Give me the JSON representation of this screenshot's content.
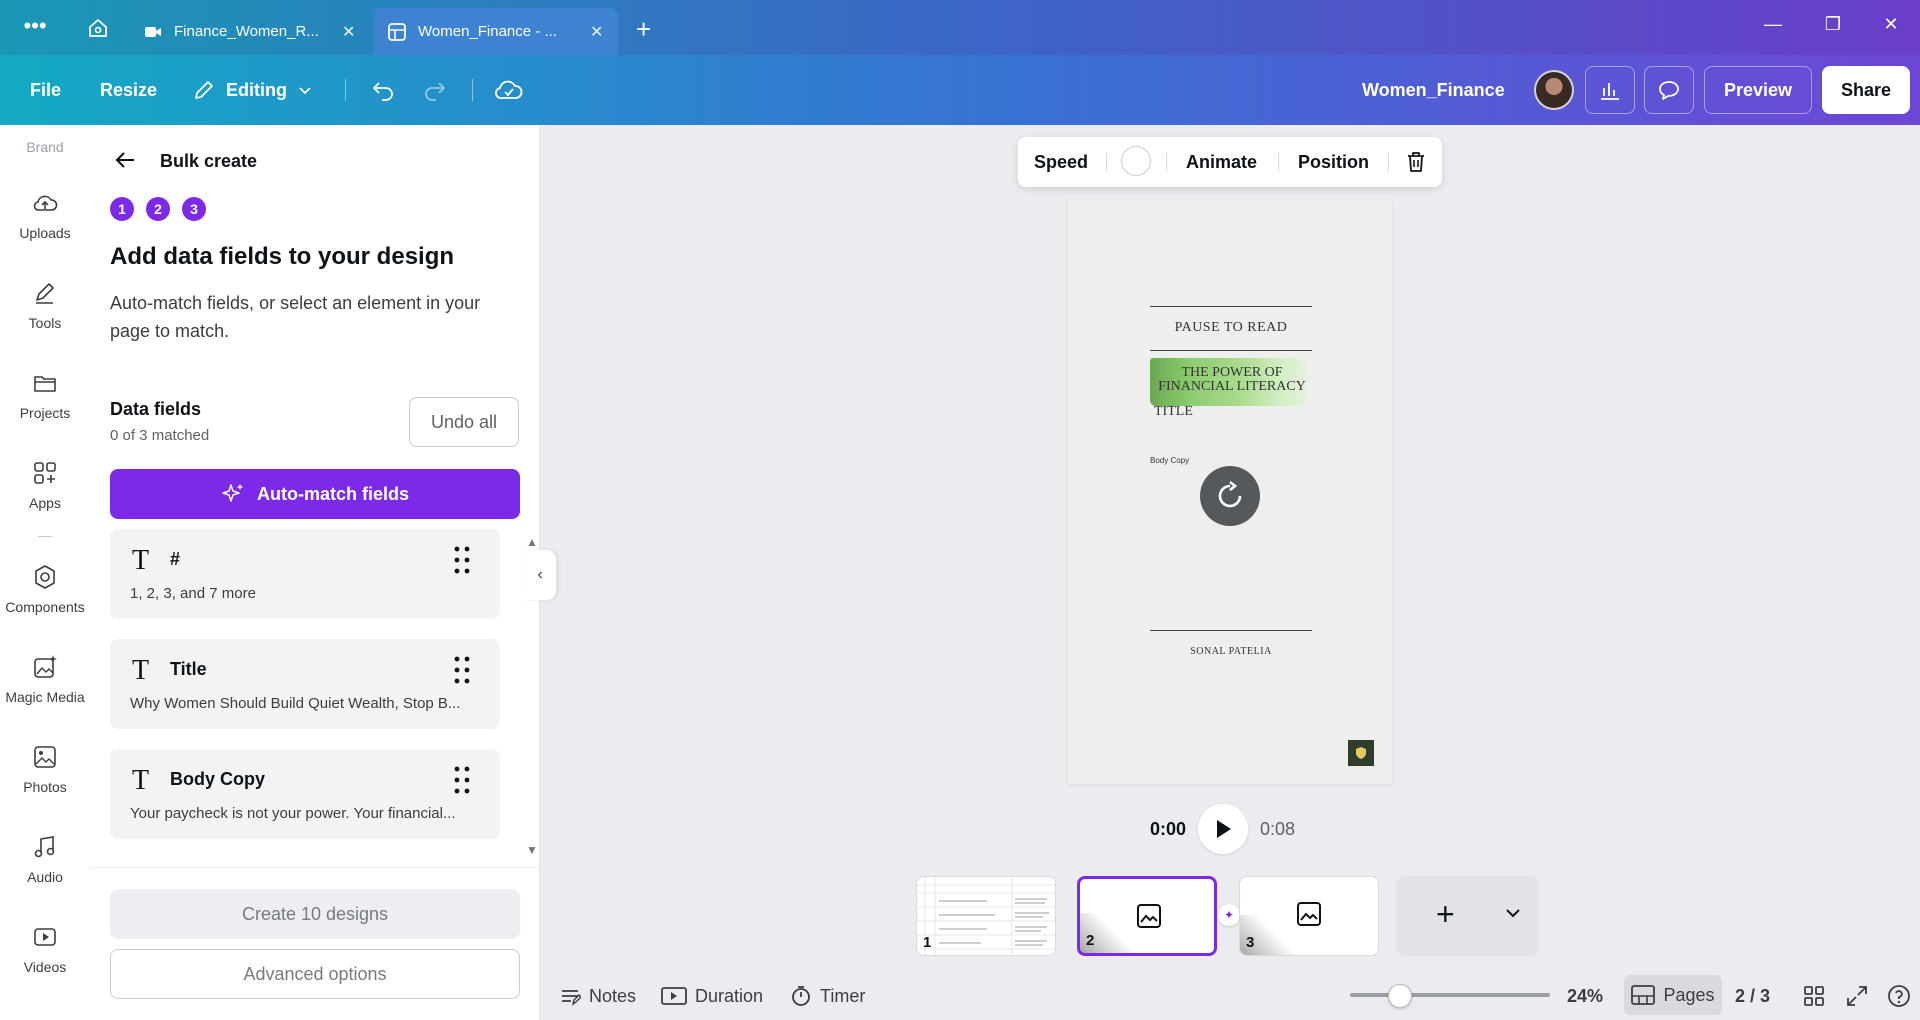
{
  "browser": {
    "tabs": [
      {
        "title": "Finance_Women_R...",
        "icon": "video-camera-icon",
        "active": false
      },
      {
        "title": "Women_Finance - ...",
        "icon": "sheet-icon",
        "active": true
      }
    ]
  },
  "toolbar": {
    "file": "File",
    "resize": "Resize",
    "editing": "Editing",
    "doc_title": "Women_Finance",
    "preview": "Preview",
    "share": "Share"
  },
  "rail": {
    "brand": "Brand",
    "items": [
      {
        "label": "Uploads",
        "icon": "upload-cloud-icon"
      },
      {
        "label": "Tools",
        "icon": "pen-icon"
      },
      {
        "label": "Projects",
        "icon": "folder-icon"
      },
      {
        "label": "Apps",
        "icon": "apps-grid-icon"
      },
      {
        "label": "Components",
        "icon": "components-icon"
      },
      {
        "label": "Magic Media",
        "icon": "magic-media-icon"
      },
      {
        "label": "Photos",
        "icon": "image-icon"
      },
      {
        "label": "Audio",
        "icon": "music-note-icon"
      },
      {
        "label": "Videos",
        "icon": "video-icon"
      }
    ]
  },
  "panel": {
    "title": "Bulk create",
    "steps": [
      "1",
      "2",
      "3"
    ],
    "heading": "Add data fields to your design",
    "description": "Auto-match fields, or select an element in your page to match.",
    "data_fields_title": "Data fields",
    "matched": "0 of 3 matched",
    "undo_all": "Undo all",
    "auto_match": "Auto-match fields",
    "fields": [
      {
        "name": "#",
        "value": "1, 2, 3, and 7 more"
      },
      {
        "name": "Title",
        "value": "Why Women Should Build Quiet Wealth, Stop B..."
      },
      {
        "name": "Body Copy",
        "value": "Your paycheck is not your power. Your financial..."
      }
    ],
    "create_button": "Create 10 designs",
    "advanced_button": "Advanced options"
  },
  "context_bar": {
    "speed": "Speed",
    "animate": "Animate",
    "position": "Position"
  },
  "canvas": {
    "pause": "PAUSE TO READ",
    "headline_1": "THE POWER OF",
    "headline_2": "FINANCIAL LITERACY",
    "title_placeholder": "TITLE",
    "body_placeholder": "Body Copy",
    "author": "SONAL PATELIA"
  },
  "playback": {
    "current": "0:00",
    "total": "0:08"
  },
  "pages": {
    "thumbs": [
      "1",
      "2",
      "3"
    ],
    "active": 2
  },
  "bottombar": {
    "notes": "Notes",
    "duration": "Duration",
    "timer": "Timer",
    "zoom": "24%",
    "pages": "Pages",
    "page_count": "2 / 3",
    "zoom_level": 0.24
  },
  "colors": {
    "accent": "#7d2ae8",
    "toolbar_start": "#14a9c4",
    "toolbar_end": "#6e46d6"
  }
}
